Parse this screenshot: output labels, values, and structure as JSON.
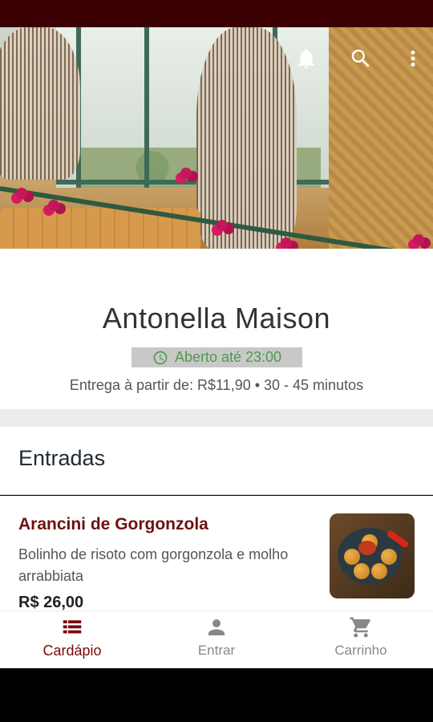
{
  "restaurant": {
    "name": "Antonella Maison",
    "status": "Aberto até 23:00",
    "delivery": "Entrega à partir de: R$11,90 • 30 - 45 minutos"
  },
  "header_icons": [
    "bell-icon",
    "search-icon",
    "more-vert-icon"
  ],
  "section": {
    "title": "Entradas"
  },
  "menu_items": [
    {
      "name": "Arancini de Gorgonzola",
      "description": "Bolinho de risoto com gorgonzola e molho arrabbiata",
      "price": "R$ 26,00"
    }
  ],
  "bottom_nav": {
    "items": [
      {
        "label": "Cardápio",
        "icon": "menu-list-icon",
        "active": true
      },
      {
        "label": "Entrar",
        "icon": "person-icon",
        "active": false
      },
      {
        "label": "Carrinho",
        "icon": "cart-icon",
        "active": false
      }
    ]
  },
  "colors": {
    "status_bar": "#3a0004",
    "accent": "#7a0a0a",
    "open_text": "#4f9a4a",
    "open_bg": "#c8c8c8"
  }
}
